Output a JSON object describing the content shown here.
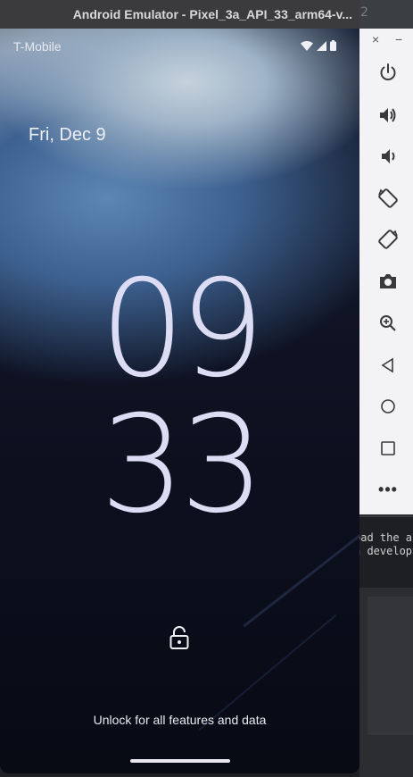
{
  "window": {
    "title": "Android Emulator - Pixel_3a_API_33_arm64-v...",
    "background_number": "2"
  },
  "status_bar": {
    "carrier": "T-Mobile",
    "icons": [
      "wifi-icon",
      "signal-icon",
      "battery-icon"
    ]
  },
  "lockscreen": {
    "date": "Fri, Dec 9",
    "hour": "09",
    "minute": "33",
    "unlock_text": "Unlock for all features and data",
    "lock_icon": "padlock-icon"
  },
  "side_panel": {
    "close_label": "×",
    "minimize_label": "−",
    "buttons": [
      "power-icon",
      "volume-up-icon",
      "volume-down-icon",
      "rotate-left-icon",
      "rotate-right-icon",
      "screenshot-icon",
      "zoom-icon",
      "back-icon",
      "home-icon",
      "overview-icon",
      "more-icon"
    ],
    "more_label": "•••"
  },
  "background_console": {
    "line1": "oad the a",
    "line2": "n develop"
  },
  "colors": {
    "clock": "#dcdcf5",
    "panel_bg": "#f3f3f5",
    "panel_icon": "#3a3a3c",
    "titlebar": "#3b3b3d"
  }
}
